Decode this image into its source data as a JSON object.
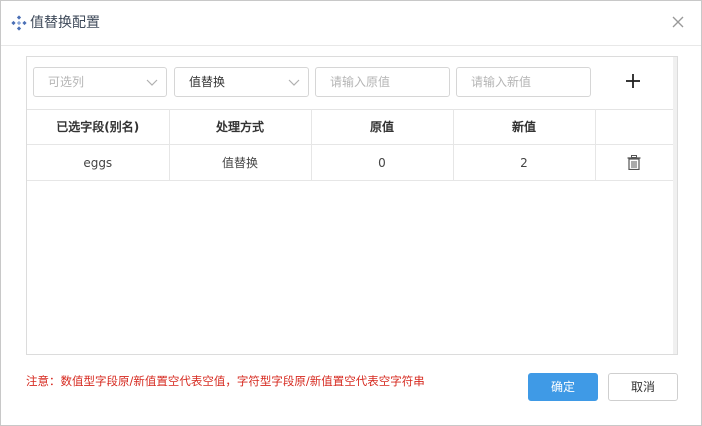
{
  "dialog": {
    "title": "值替换配置",
    "icon": "diamond-dots-icon",
    "close_icon": "close-icon"
  },
  "toolbar": {
    "field_select": {
      "placeholder": "可选列"
    },
    "method_select": {
      "value": "值替换"
    },
    "old_value_input": {
      "placeholder": "请输入原值"
    },
    "new_value_input": {
      "placeholder": "请输入新值"
    },
    "add_icon": "plus-icon"
  },
  "table": {
    "headers": [
      "已选字段(别名)",
      "处理方式",
      "原值",
      "新值",
      ""
    ],
    "rows": [
      {
        "field": "eggs",
        "method": "值替换",
        "old": "0",
        "new": "2",
        "action_icon": "trash-icon"
      }
    ]
  },
  "footer": {
    "note": "注意：数值型字段原/新值置空代表空值，字符型字段原/新值置空代表空字符串",
    "ok_label": "确定",
    "cancel_label": "取消"
  },
  "colors": {
    "primary": "#3f9ae6",
    "warning_text": "#d6291f",
    "title_text": "#3f4a5a"
  }
}
